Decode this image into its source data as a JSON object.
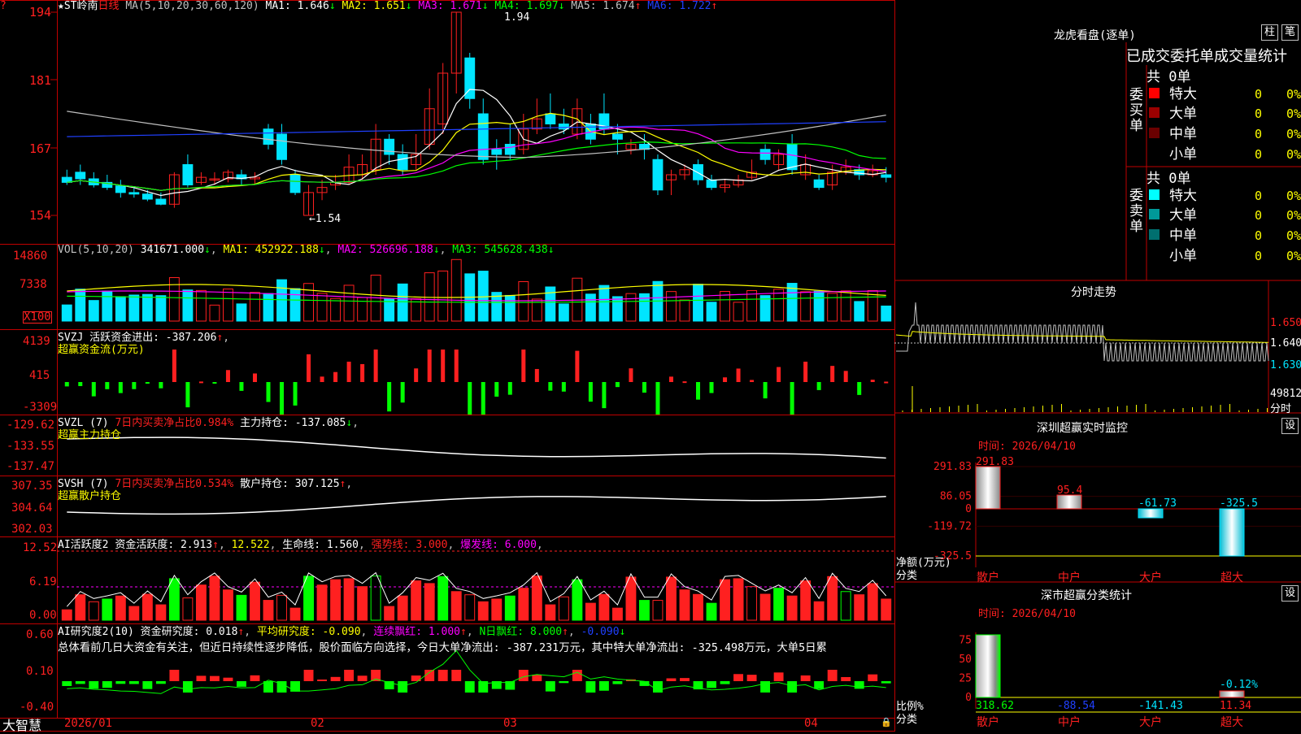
{
  "colors": {
    "up": "#ff2020",
    "down": "#00e5ff",
    "grid": "#c00000",
    "ma1": "#ffffff",
    "ma2": "#ffff00",
    "ma3": "#ff00ff",
    "ma4": "#00ff00",
    "ma5": "#c0c0c0",
    "ma6": "#2040ff",
    "green": "#00ff00",
    "yellow": "#ffff00",
    "magenta": "#ff00ff"
  },
  "header": {
    "star": "★",
    "name": "ST岭南",
    "period": "日线",
    "ma_def": "MA(5,10,20,30,60,120)",
    "ma_items": [
      {
        "label": "MA1: 1.646",
        "arrow": "↓"
      },
      {
        "label": "MA2: 1.651",
        "arrow": "↓"
      },
      {
        "label": "MA3: 1.671",
        "arrow": "↓"
      },
      {
        "label": "MA4: 1.697",
        "arrow": "↓"
      },
      {
        "label": "MA5: 1.674",
        "arrow": "↑"
      },
      {
        "label": "MA6: 1.722",
        "arrow": "↑"
      }
    ]
  },
  "price_axis": {
    "ticks": [
      "194",
      "181",
      "167",
      "154"
    ],
    "high_label": "1.94",
    "low_label": "←1.54"
  },
  "vol": {
    "title": "VOL(5,10,20)",
    "value": "341671.000",
    "ma1": "MA1: 452922.188",
    "ma2": "MA2: 526696.188",
    "ma3": "MA3: 545628.438",
    "ticks": [
      "14860",
      "7338"
    ],
    "unit": "X100"
  },
  "svzj": {
    "title": "SVZJ  活跃资金进出: -387.206",
    "sub": "超赢资金流(万元)",
    "ticks": [
      "4139",
      "415",
      "-3309"
    ]
  },
  "svzl": {
    "title": "SVZL (7)",
    "pct": "7日内买卖净占比0.984%",
    "value": "主力持仓: -137.085",
    "sub": "超赢主力持仓",
    "ticks": [
      "-129.62",
      "-133.55",
      "-137.47"
    ]
  },
  "svsh": {
    "title": "SVSH (7)",
    "pct": "7日内买卖净占比0.534%",
    "value": "散户持仓: 307.125",
    "sub": "超赢散户持仓",
    "ticks": [
      "307.35",
      "304.64",
      "302.03"
    ]
  },
  "ai1": {
    "title": "AI活跃度2",
    "a": "资金活跃度: 2.913",
    "b": "12.522",
    "c": "生命线: 1.560",
    "d": "强势线: 3.000",
    "e": "爆发线: 6.000",
    "ticks": [
      "12.52",
      "6.19",
      "0.00"
    ]
  },
  "ai2": {
    "title": "AI研究度2(10)",
    "a": "资金研究度: 0.018",
    "b": "平均研究度: -0.090",
    "c": "连续飘红: 1.000",
    "d": "N日飘红: 8.000",
    "e": "-0.090",
    "ticks": [
      "0.60",
      "0.10",
      "-0.40"
    ],
    "commentary": "总体看前几日大资金有关注，但近日持续性逐步降低，股价面临方向选择，今日大单净流出: -387.231万元，其中特大单净流出: -325.498万元，大单5日累"
  },
  "date_axis": {
    "brand": "大智慧",
    "labels": [
      "2026/01",
      "02",
      "03",
      "04"
    ]
  },
  "lhb": {
    "title": "龙虎看盘(逐单)",
    "btn1": "柱",
    "btn2": "笔",
    "subtitle": "已成交委托单成交量统计",
    "buy_side": "委买单",
    "sell_side": "委卖单",
    "total": "共 0单",
    "rows": [
      {
        "label": "特大",
        "v": "0",
        "p": "0%"
      },
      {
        "label": "大单",
        "v": "0",
        "p": "0%"
      },
      {
        "label": "中单",
        "v": "0",
        "p": "0%"
      },
      {
        "label": "小单",
        "v": "0",
        "p": "0%"
      }
    ]
  },
  "fenshi": {
    "title": "分时走势",
    "ticks": [
      "1.650",
      "1.640",
      "1.630"
    ],
    "vol_label": "49812",
    "unit": "分时"
  },
  "sz_monitor": {
    "title": "深圳超赢实时监控",
    "btn": "设",
    "time": "时间: 2026/04/10",
    "ylabel": "净额(万元)",
    "xlabel": "分类",
    "ticks": [
      "291.83",
      "86.05",
      "0",
      "-119.72",
      "-325.5"
    ],
    "chart_data": {
      "type": "bar",
      "categories": [
        "散户",
        "中户",
        "大户",
        "超大"
      ],
      "values": [
        291.83,
        95.4,
        -61.73,
        -325.5
      ],
      "value_labels": [
        "291.83",
        "95.4",
        "-61.73",
        "-325.5"
      ],
      "ylim": [
        -325.5,
        291.83
      ]
    }
  },
  "sz_class": {
    "title": "深市超赢分类统计",
    "btn": "设",
    "time": "时间: 2026/04/10",
    "ylabel": "比例%",
    "xlabel": "分类",
    "ticks": [
      "75",
      "50",
      "25",
      "0"
    ],
    "chart_data": {
      "type": "bar",
      "categories": [
        "散户",
        "中户",
        "大户",
        "超大"
      ],
      "values": [
        318.62,
        -88.54,
        -141.43,
        11.34
      ],
      "value_labels": [
        "318.62",
        "-88.54",
        "-141.43",
        "11.34"
      ],
      "top_label": "-0.12%"
    }
  },
  "chart_data": {
    "type": "candlestick",
    "candles": [
      [
        1.615,
        1.605,
        1.63,
        1.6
      ],
      [
        1.625,
        1.612,
        1.64,
        1.6
      ],
      [
        1.612,
        1.6,
        1.625,
        1.595
      ],
      [
        1.605,
        1.595,
        1.62,
        1.59
      ],
      [
        1.598,
        1.585,
        1.61,
        1.575
      ],
      [
        1.585,
        1.582,
        1.595,
        1.575
      ],
      [
        1.582,
        1.572,
        1.59,
        1.568
      ],
      [
        1.572,
        1.562,
        1.585,
        1.56
      ],
      [
        1.562,
        1.62,
        1.625,
        1.555
      ],
      [
        1.64,
        1.6,
        1.66,
        1.595
      ],
      [
        1.605,
        1.615,
        1.625,
        1.6
      ],
      [
        1.61,
        1.612,
        1.625,
        1.6
      ],
      [
        1.612,
        1.625,
        1.63,
        1.605
      ],
      [
        1.62,
        1.612,
        1.63,
        1.6
      ],
      [
        1.612,
        1.615,
        1.625,
        1.6
      ],
      [
        1.71,
        1.68,
        1.72,
        1.67
      ],
      [
        1.7,
        1.65,
        1.72,
        1.64
      ],
      [
        1.62,
        1.585,
        1.63,
        1.58
      ],
      [
        1.54,
        1.585,
        1.6,
        1.54
      ],
      [
        1.585,
        1.595,
        1.61,
        1.57
      ],
      [
        1.6,
        1.605,
        1.62,
        1.59
      ],
      [
        1.605,
        1.635,
        1.66,
        1.6
      ],
      [
        1.62,
        1.64,
        1.66,
        1.61
      ],
      [
        1.63,
        1.69,
        1.72,
        1.62
      ],
      [
        1.69,
        1.66,
        1.7,
        1.64
      ],
      [
        1.66,
        1.63,
        1.68,
        1.62
      ],
      [
        1.64,
        1.66,
        1.7,
        1.63
      ],
      [
        1.68,
        1.75,
        1.79,
        1.67
      ],
      [
        1.72,
        1.82,
        1.84,
        1.7
      ],
      [
        1.82,
        1.94,
        1.94,
        1.78
      ],
      [
        1.85,
        1.77,
        1.86,
        1.75
      ],
      [
        1.74,
        1.65,
        1.77,
        1.64
      ],
      [
        1.67,
        1.66,
        1.69,
        1.63
      ],
      [
        1.68,
        1.66,
        1.72,
        1.65
      ],
      [
        1.67,
        1.71,
        1.74,
        1.66
      ],
      [
        1.71,
        1.73,
        1.77,
        1.7
      ],
      [
        1.74,
        1.72,
        1.78,
        1.71
      ],
      [
        1.72,
        1.71,
        1.75,
        1.7
      ],
      [
        1.7,
        1.75,
        1.77,
        1.69
      ],
      [
        1.72,
        1.69,
        1.74,
        1.68
      ],
      [
        1.74,
        1.71,
        1.78,
        1.7
      ],
      [
        1.7,
        1.69,
        1.72,
        1.66
      ],
      [
        1.67,
        1.68,
        1.69,
        1.66
      ],
      [
        1.68,
        1.67,
        1.7,
        1.65
      ],
      [
        1.65,
        1.59,
        1.66,
        1.58
      ],
      [
        1.61,
        1.62,
        1.63,
        1.58
      ],
      [
        1.62,
        1.63,
        1.64,
        1.61
      ],
      [
        1.64,
        1.61,
        1.65,
        1.6
      ],
      [
        1.61,
        1.595,
        1.62,
        1.59
      ],
      [
        1.595,
        1.6,
        1.61,
        1.585
      ],
      [
        1.6,
        1.61,
        1.62,
        1.595
      ],
      [
        1.615,
        1.625,
        1.65,
        1.61
      ],
      [
        1.67,
        1.65,
        1.68,
        1.64
      ],
      [
        1.64,
        1.66,
        1.67,
        1.63
      ],
      [
        1.68,
        1.63,
        1.7,
        1.62
      ],
      [
        1.62,
        1.64,
        1.66,
        1.61
      ],
      [
        1.61,
        1.595,
        1.62,
        1.59
      ],
      [
        1.6,
        1.625,
        1.64,
        1.59
      ],
      [
        1.625,
        1.635,
        1.65,
        1.62
      ],
      [
        1.63,
        1.62,
        1.64,
        1.61
      ],
      [
        1.62,
        1.628,
        1.64,
        1.615
      ],
      [
        1.62,
        1.615,
        1.635,
        1.605
      ]
    ],
    "ylim": [
      1.53,
      1.96
    ]
  }
}
